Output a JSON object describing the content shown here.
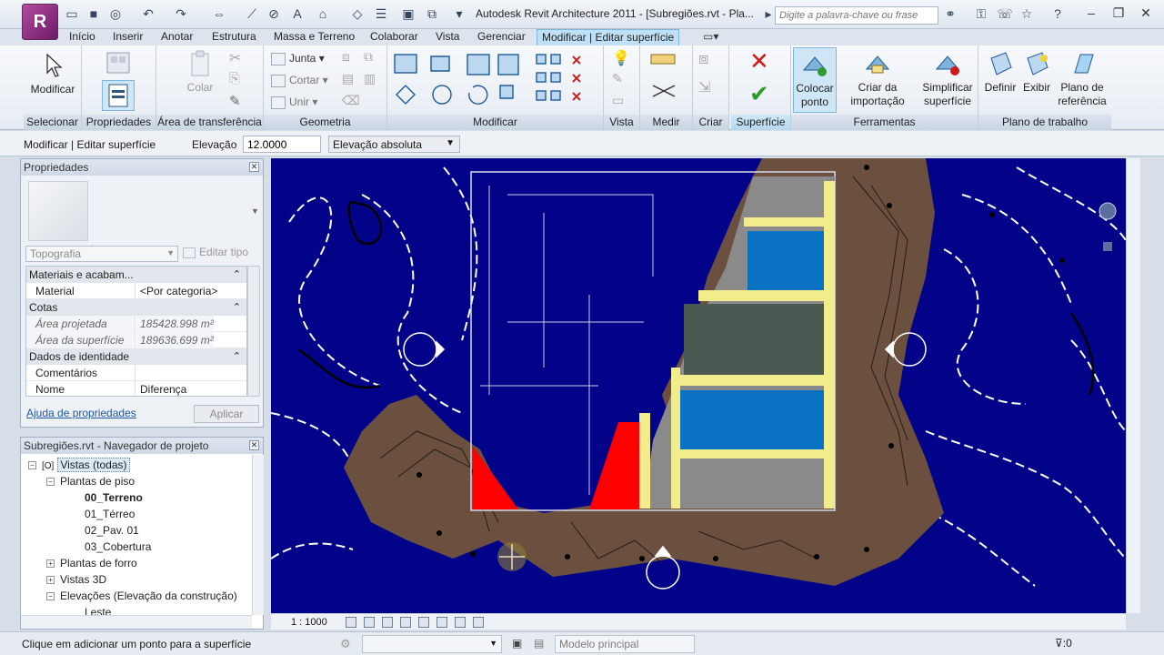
{
  "app": {
    "logo_letter": "R",
    "title": "Autodesk Revit Architecture 2011 - [Subregiões.rvt - Pla...",
    "search_placeholder": "Digite a palavra-chave ou frase"
  },
  "tabs": [
    {
      "label": "Início"
    },
    {
      "label": "Inserir"
    },
    {
      "label": "Anotar"
    },
    {
      "label": "Estrutura"
    },
    {
      "label": "Massa e Terreno"
    },
    {
      "label": "Colaborar"
    },
    {
      "label": "Vista"
    },
    {
      "label": "Gerenciar"
    },
    {
      "label": "Modificar | Editar superfície"
    }
  ],
  "ribbon": {
    "select": {
      "title": "Selecionar",
      "modify": "Modificar"
    },
    "properties": {
      "title": "Propriedades"
    },
    "clipboard": {
      "title": "Área de transferência",
      "paste": "Colar"
    },
    "geometry": {
      "title": "Geometria",
      "join": "Junta",
      "cut": "Cortar",
      "unjoin": "Unir"
    },
    "modify": {
      "title": "Modificar"
    },
    "view": {
      "title": "Vista"
    },
    "measure": {
      "title": "Medir"
    },
    "create": {
      "title": "Criar"
    },
    "surface": {
      "title": "Superfície"
    },
    "tools": {
      "title": "Ferramentas",
      "place_point": "Colocar ponto",
      "create_import": "Criar da importação",
      "simplify": "Simplificar superfície"
    },
    "workplane": {
      "title": "Plano de trabalho",
      "set": "Definir",
      "show": "Exibir",
      "ref_plane": "Plano de referência"
    }
  },
  "options_bar": {
    "context": "Modificar | Editar superfície",
    "elevation_label": "Elevação",
    "elevation_value": "12.0000",
    "elevation_mode": "Elevação absoluta"
  },
  "properties": {
    "title": "Propriedades",
    "type_name": "Topografia",
    "edit_type": "Editar tipo",
    "sections": [
      {
        "name": "Materiais e acabam...",
        "rows": [
          {
            "name": "Material",
            "value": "<Por categoria>"
          }
        ]
      },
      {
        "name": "Cotas",
        "rows": [
          {
            "name": "Área projetada",
            "value": "185428.998 m²"
          },
          {
            "name": "Área da superfície",
            "value": "189636.699 m²"
          }
        ]
      },
      {
        "name": "Dados de identidade",
        "rows": [
          {
            "name": "Comentários",
            "value": ""
          },
          {
            "name": "Nome",
            "value": "Diferença"
          }
        ]
      }
    ],
    "help_link": "Ajuda de propriedades",
    "apply": "Aplicar"
  },
  "browser": {
    "title": "Subregiões.rvt - Navegador de projeto",
    "nodes": [
      {
        "label": "Vistas (todas)"
      },
      {
        "label": "Plantas de piso"
      },
      {
        "label": "00_Terreno"
      },
      {
        "label": "01_Térreo"
      },
      {
        "label": "02_Pav. 01"
      },
      {
        "label": "03_Cobertura"
      },
      {
        "label": "Plantas de forro"
      },
      {
        "label": "Vistas 3D"
      },
      {
        "label": "Elevações (Elevação da construção)"
      },
      {
        "label": "Leste"
      }
    ]
  },
  "view_control": {
    "scale": "1 : 1000"
  },
  "status": {
    "message": "Clique em adicionar um ponto para a superfície",
    "model": "Modelo principal",
    "filter_count": ":0"
  },
  "colors": {
    "terrain_background": "#03038a",
    "topography": "#6b4f3f",
    "building_gray": "#8a8a8a",
    "building_blue": "#0a72c2",
    "building_yellow": "#f2ed8a",
    "subregion_red": "#ff0000"
  }
}
